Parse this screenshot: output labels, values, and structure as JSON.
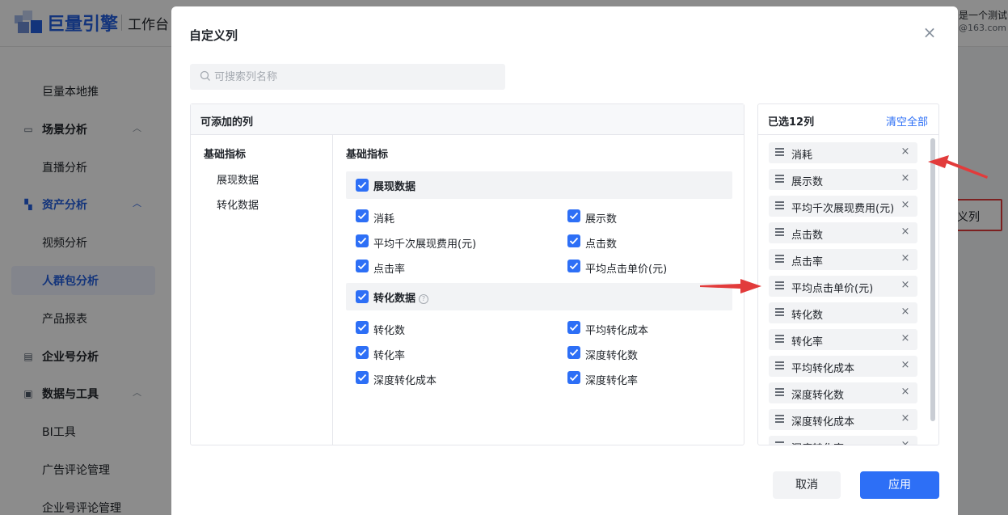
{
  "app": {
    "logo_text": "巨量引擎",
    "logo_sub": "工作台",
    "account_name": "是一个测试号",
    "account_email": "@163.com"
  },
  "sidebar": {
    "items": [
      {
        "label": "巨量本地推",
        "type": "item"
      },
      {
        "label": "场景分析",
        "type": "group",
        "icon": "chart-icon"
      },
      {
        "label": "直播分析",
        "type": "item"
      },
      {
        "label": "资产分析",
        "type": "group",
        "icon": "assets-icon"
      },
      {
        "label": "视频分析",
        "type": "item"
      },
      {
        "label": "人群包分析",
        "type": "item",
        "active": true
      },
      {
        "label": "产品报表",
        "type": "item"
      },
      {
        "label": "企业号分析",
        "type": "group",
        "icon": "enterprise-icon"
      },
      {
        "label": "数据与工具",
        "type": "group",
        "icon": "tools-icon"
      },
      {
        "label": "BI工具",
        "type": "item"
      },
      {
        "label": "广告评论管理",
        "type": "item"
      },
      {
        "label": "企业号评论管理",
        "type": "item"
      }
    ]
  },
  "background": {
    "custom_col_button": "义列"
  },
  "modal": {
    "title": "自定义列",
    "search_placeholder": "可搜索列名称",
    "available_header": "可添加的列",
    "categories": {
      "title": "基础指标",
      "subs": [
        "展现数据",
        "转化数据"
      ]
    },
    "options_title": "基础指标",
    "groups": [
      {
        "label": "展现数据",
        "help": false,
        "items": [
          "消耗",
          "展示数",
          "平均千次展现费用(元)",
          "点击数",
          "点击率",
          "平均点击单价(元)"
        ]
      },
      {
        "label": "转化数据",
        "help": true,
        "items": [
          "转化数",
          "平均转化成本",
          "转化率",
          "深度转化数",
          "深度转化成本",
          "深度转化率"
        ]
      }
    ],
    "selected_count_label": "已选12列",
    "clear_all": "清空全部",
    "selected": [
      "消耗",
      "展示数",
      "平均千次展现费用(元)",
      "点击数",
      "点击率",
      "平均点击单价(元)",
      "转化数",
      "转化率",
      "平均转化成本",
      "深度转化数",
      "深度转化成本",
      "深度转化率"
    ],
    "cancel": "取消",
    "apply": "应用"
  },
  "colors": {
    "brand_blue": "#2d6ff6",
    "annotation_red": "#e23b3b"
  }
}
